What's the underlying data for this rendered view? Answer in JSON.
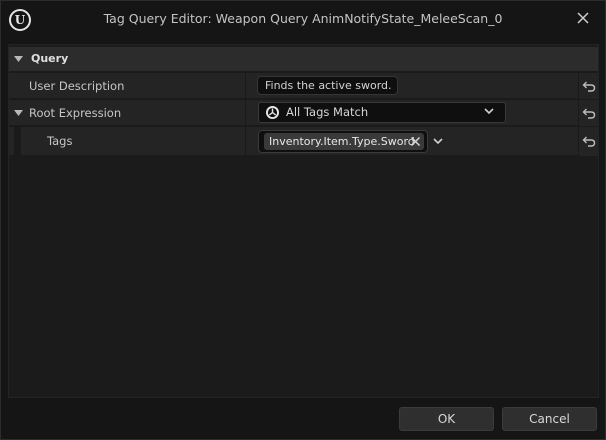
{
  "window": {
    "title": "Tag Query Editor: Weapon Query AnimNotifyState_MeleeScan_0",
    "logo_glyph": "U"
  },
  "category": {
    "label": "Query"
  },
  "properties": {
    "user_description": {
      "label": "User Description",
      "value": "Finds the active sword."
    },
    "root_expression": {
      "label": "Root Expression",
      "value": "All Tags Match"
    },
    "tags": {
      "label": "Tags",
      "items": [
        "Inventory.Item.Type.Sword"
      ]
    }
  },
  "buttons": {
    "ok": "OK",
    "cancel": "Cancel"
  },
  "icons": {
    "logo": "unreal-logo-icon",
    "close": "close-icon",
    "reset": "reset-to-default-icon",
    "expand": "triangle-down-icon",
    "expression": "expression-type-icon",
    "dropdown": "chevron-down-icon",
    "remove": "remove-tag-icon"
  },
  "colors": {
    "background": "#151515",
    "panel": "#1b1b1b",
    "row": "#242424",
    "category": "#2c2c2c",
    "text": "#c8c8c8"
  }
}
